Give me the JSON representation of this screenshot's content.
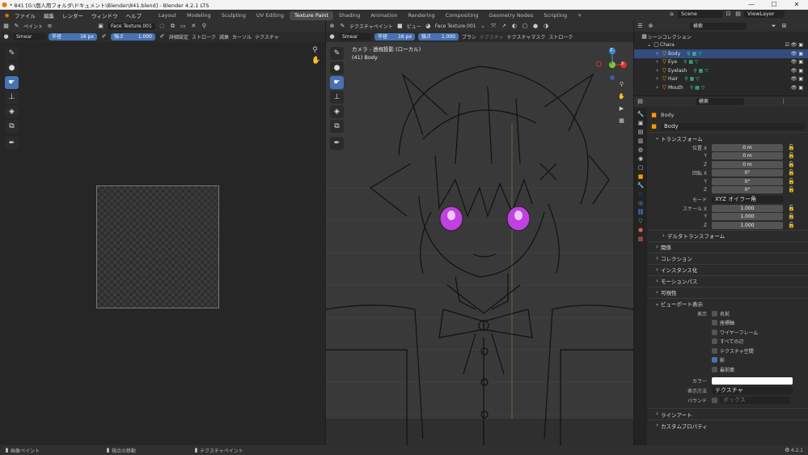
{
  "title_bar": {
    "title": "* 841 [G:\\個人用フォルダ\\ドキュメント\\Blender\\841.blend] - Blender 4.2.1 LTS",
    "minimize": "—",
    "maximize": "☐",
    "close": "✕"
  },
  "menu": [
    "ファイル",
    "編集",
    "レンダー",
    "ウィンドウ",
    "ヘルプ"
  ],
  "workspaces": [
    "Layout",
    "Modeling",
    "Sculpting",
    "UV Editing",
    "Texture Paint",
    "Shading",
    "Animation",
    "Rendering",
    "Compositing",
    "Geometry Nodes",
    "Scripting"
  ],
  "active_workspace": "Texture Paint",
  "scene_name": "Scene",
  "view_layer": "ViewLayer",
  "left_editor": {
    "mode": "ペイント",
    "image_name": "Face Texture.001",
    "brush": "Smear",
    "radius_label": "半径",
    "radius_value": "16 px",
    "strength_label": "強さ",
    "strength_value": "1.000",
    "menus": [
      "詳細設定",
      "ストローク",
      "減衰",
      "カーソル",
      "テクスチャ"
    ]
  },
  "viewport": {
    "mode": "テクスチャペイント",
    "view_label": "ビュー",
    "texture_name": "Face Texture.001",
    "brush": "Smear",
    "radius_label": "半径",
    "radius_value": "16 px",
    "strength_label": "強さ",
    "strength_value": "1.000",
    "menus": [
      "ブラシ",
      "テクスチャ",
      "テクスチャマスク",
      "ストローク"
    ],
    "overlay_line1": "カメラ - 透視投影 (ローカル)",
    "overlay_line2": "(41) Body",
    "gizmo": {
      "x": "X",
      "y": "Y",
      "z": "Z"
    }
  },
  "outliner": {
    "search_placeholder": "検索",
    "scene_collection": "シーンコレクション",
    "collection": "Chara",
    "items": [
      "Body",
      "Eye",
      "Eyelash",
      "Hair",
      "Mouth"
    ],
    "selected": "Body"
  },
  "properties": {
    "search_placeholder": "検索",
    "object_name": "Body",
    "data_name": "Body",
    "transform_header": "トランスフォーム",
    "location_label": "位置 X",
    "rotation_label": "回転 X",
    "scale_label": "スケール X",
    "axes": [
      "X",
      "Y",
      "Z"
    ],
    "location": [
      "0 m",
      "0 m",
      "0 m"
    ],
    "rotation": [
      "0°",
      "0°",
      "0°"
    ],
    "mode_label": "モード",
    "mode_value": "XYZ オイラー角",
    "scale": [
      "1.000",
      "1.000",
      "1.000"
    ],
    "delta_header": "デルタトランスフォーム",
    "sections": [
      "関係",
      "コレクション",
      "インスタンス化",
      "モーションパス",
      "可視性"
    ],
    "viewport_display_header": "ビューポート表示",
    "display_label": "表示",
    "display_items": [
      {
        "label": "名前",
        "checked": false
      },
      {
        "label": "座標軸",
        "checked": false
      },
      {
        "label": "ワイヤーフレーム",
        "checked": false
      },
      {
        "label": "すべての辺",
        "checked": false
      },
      {
        "label": "テクスチャ空間",
        "checked": false
      },
      {
        "label": "影",
        "checked": true
      },
      {
        "label": "最前面",
        "checked": false
      }
    ],
    "color_label": "カラー",
    "display_as_label": "表示方法",
    "display_as_value": "テクスチャ",
    "bounds_label": "バウンド",
    "bounds_value": "ボックス",
    "line_art": "ラインアート",
    "custom_props": "カスタムプロパティ"
  },
  "status_bar": {
    "item1": "画像ペイント",
    "item2": "視点の移動",
    "item3": "テクスチャペイント",
    "version": "4.2.1"
  },
  "colors": {
    "accent": "#4772b3",
    "selected_row": "#334d80",
    "eye": "#c040e0"
  }
}
